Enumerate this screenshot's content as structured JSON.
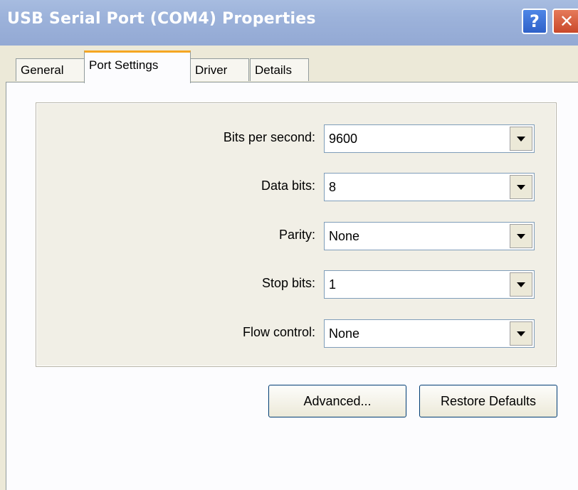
{
  "window": {
    "title": "USB Serial Port (COM4) Properties",
    "help_icon": "?",
    "close_icon": "✕"
  },
  "tabs": [
    {
      "label": "General"
    },
    {
      "label": "Port Settings"
    },
    {
      "label": "Driver"
    },
    {
      "label": "Details"
    }
  ],
  "settings": {
    "bits_per_second": {
      "label": "Bits per second:",
      "value": "9600"
    },
    "data_bits": {
      "label": "Data bits:",
      "value": "8"
    },
    "parity": {
      "label": "Parity:",
      "value": "None"
    },
    "stop_bits": {
      "label": "Stop bits:",
      "value": "1"
    },
    "flow_control": {
      "label": "Flow control:",
      "value": "None"
    }
  },
  "buttons": {
    "advanced": "Advanced...",
    "restore_defaults": "Restore Defaults"
  },
  "colors": {
    "titlebar": "#9cb2da",
    "active_tab_accent": "#f5a623",
    "close_button": "#c9482a",
    "help_button": "#2f61c9"
  }
}
